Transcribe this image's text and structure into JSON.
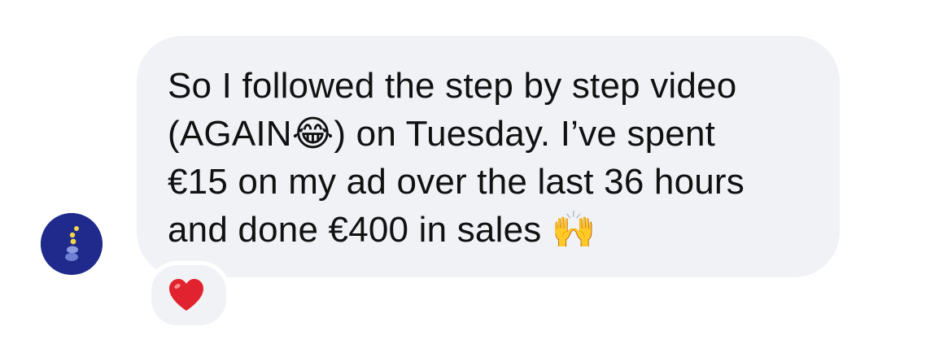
{
  "conversation": {
    "incoming_message": {
      "lines": [
        "So I followed the step by step video",
        "(AGAIN😂) on Tuesday. I’ve spent",
        "€15 on my ad over the last 36 hours",
        "and done €400 in sales 🙌"
      ],
      "reaction": "❤️"
    },
    "sender": {
      "avatar_icon": "stacked-stones-icon",
      "avatar_color": "#1f2a8c"
    }
  },
  "colors": {
    "bubble_background": "#f1f2f6",
    "text": "#111111",
    "heart": "#e0232e"
  }
}
